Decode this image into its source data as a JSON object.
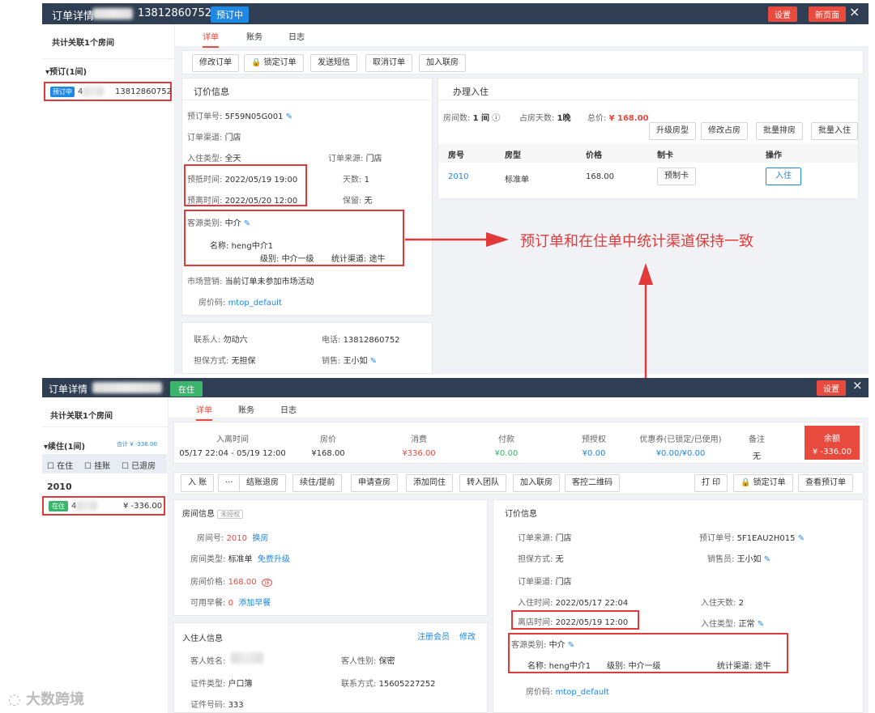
{
  "top": {
    "header": {
      "title": "订单详情",
      "phone": "13812860752",
      "status_tag": "预订中",
      "settings": "设置",
      "new_page": "新页面",
      "close": "×"
    },
    "left": {
      "linked": "共计关联1个房间",
      "group": "▾预订(1间)",
      "item_tag": "预订中",
      "item_num": "4",
      "item_phone": "13812860752"
    },
    "tabs": [
      "详单",
      "账务",
      "日志"
    ],
    "actions": [
      "修改订单",
      "锁定订单",
      "发送短信",
      "取消订单",
      "加入联房"
    ],
    "order_info": {
      "title": "订价信息",
      "booking_no_label": "预订单号:",
      "booking_no": "5F59N05G001",
      "channel_label": "订单渠道:",
      "channel": "门店",
      "checkin_type_label": "入住类型:",
      "checkin_type": "全天",
      "source_label": "订单来源:",
      "source": "门店",
      "arrive_label": "预抵时间:",
      "arrive": "2022/05/19 19:00",
      "days_label": "天数:",
      "days": "1",
      "leave_label": "预离时间:",
      "leave": "2022/05/20 12:00",
      "guarantee_label": "保留:",
      "guarantee": "无",
      "guest_type_label": "客源类别:",
      "guest_type": "中介",
      "name_label": "名称:",
      "name": "heng中介1",
      "level_label": "级别:",
      "level": "中介一级",
      "stat_label": "统计渠道:",
      "stat": "途牛",
      "market_label": "市场营销:",
      "market": "当前订单未参加市场活动",
      "rate_label": "房价码:",
      "rate": "mtop_default",
      "contact_label": "联系人:",
      "contact": "勿动六",
      "phone_label": "电话:",
      "phone": "13812860752",
      "guar_label": "担保方式:",
      "guar": "无担保",
      "sales_label": "销售:",
      "sales": "王小如"
    },
    "checkin": {
      "title": "办理入住",
      "rooms_label": "房间数:",
      "rooms": "1 间",
      "nights_label": "占房天数:",
      "nights": "1晚",
      "total_label": "总价:",
      "total": "¥ 168.00",
      "buttons": [
        "升级房型",
        "修改占房",
        "批量排房",
        "批量入住"
      ],
      "headers": [
        "房号",
        "房型",
        "价格",
        "制卡",
        "操作"
      ],
      "row": {
        "room": "2010",
        "type": "标准单",
        "price": "168.00",
        "card": "预制卡",
        "action": "入住"
      }
    }
  },
  "annotation": "预订单和在住单中统计渠道保持一致",
  "bottom": {
    "header": {
      "title": "订单详情",
      "status_tag": "在住",
      "settings": "设置",
      "close": "×"
    },
    "left": {
      "linked": "共计关联1个房间",
      "group": "▾续住(1间)",
      "sum": "合计 ¥ -336.00",
      "filters": [
        "在住",
        "挂账",
        "已退房"
      ],
      "room": "2010",
      "item_tag": "在住",
      "item_num": "4",
      "item_amount": "¥ -336.00"
    },
    "tabs": [
      "详单",
      "账务",
      "日志"
    ],
    "summary": [
      {
        "label": "入离时间",
        "value": "05/17 22:04 - 05/19 12:00",
        "color": "#333"
      },
      {
        "label": "房价",
        "value": "¥168.00",
        "color": "#333"
      },
      {
        "label": "消费",
        "value": "¥336.00",
        "color": "#e84a3d"
      },
      {
        "label": "付款",
        "value": "¥0.00",
        "color": "#3ab56b"
      },
      {
        "label": "预授权",
        "value": "¥0.00",
        "color": "#1e88e5"
      },
      {
        "label": "优惠券(已锁定/已使用)",
        "value": "¥0.00/¥0.00",
        "color": "#1e88e5"
      },
      {
        "label": "备注",
        "value": "无",
        "color": "#333"
      }
    ],
    "balance": {
      "label": "余额",
      "value": "¥ -336.00"
    },
    "actions": [
      "入 账",
      "···",
      "结账退房",
      "续住/提前",
      "申请查房",
      "添加同住",
      "转入团队",
      "加入联房",
      "客控二维码"
    ],
    "right_actions": [
      "打 印",
      "锁定订单",
      "查看预订单"
    ],
    "room_info": {
      "title": "房间信息",
      "tag": "未授权",
      "room_no_label": "房间号:",
      "room_no": "2010",
      "swap": "换房",
      "type_label": "房间类型:",
      "type": "标准单",
      "upgrade": "免费升级",
      "price_label": "房间价格:",
      "price": "168.00",
      "price_icon": "详",
      "bf_label": "可用早餐:",
      "bf": "0",
      "add_bf": "添加早餐"
    },
    "guest_info": {
      "title": "入住人信息",
      "register": "注册会员",
      "edit": "修改",
      "name_label": "客人姓名:",
      "gender_label": "客人性别:",
      "gender": "保密",
      "id_type_label": "证件类型:",
      "id_type": "户口簿",
      "contact_label": "联系方式:",
      "contact": "15605227252",
      "id_no_label": "证件号码:",
      "id_no": "333"
    },
    "order_info": {
      "title": "订价信息",
      "source_label": "订单来源:",
      "source": "门店",
      "booking_label": "预订单号:",
      "booking": "5F1EAU2H015",
      "guar_label": "担保方式:",
      "guar": "无",
      "sales_label": "销售员:",
      "sales": "王小如",
      "channel_label": "订单渠道:",
      "channel": "门店",
      "in_label": "入住时间:",
      "in": "2022/05/17 22:04",
      "days_label": "入住天数:",
      "days": "2",
      "out_label": "离店时间:",
      "out": "2022/05/19 12:00",
      "type_label": "入住类型:",
      "type": "正常",
      "guest_type_label": "客源类别:",
      "guest_type": "中介",
      "name_label": "名称:",
      "name": "heng中介1",
      "level_label": "级别:",
      "level": "中介一级",
      "stat_label": "统计渠道:",
      "stat": "途牛",
      "rate_label": "房价码:",
      "rate": "mtop_default"
    }
  },
  "watermark": "大数跨境"
}
